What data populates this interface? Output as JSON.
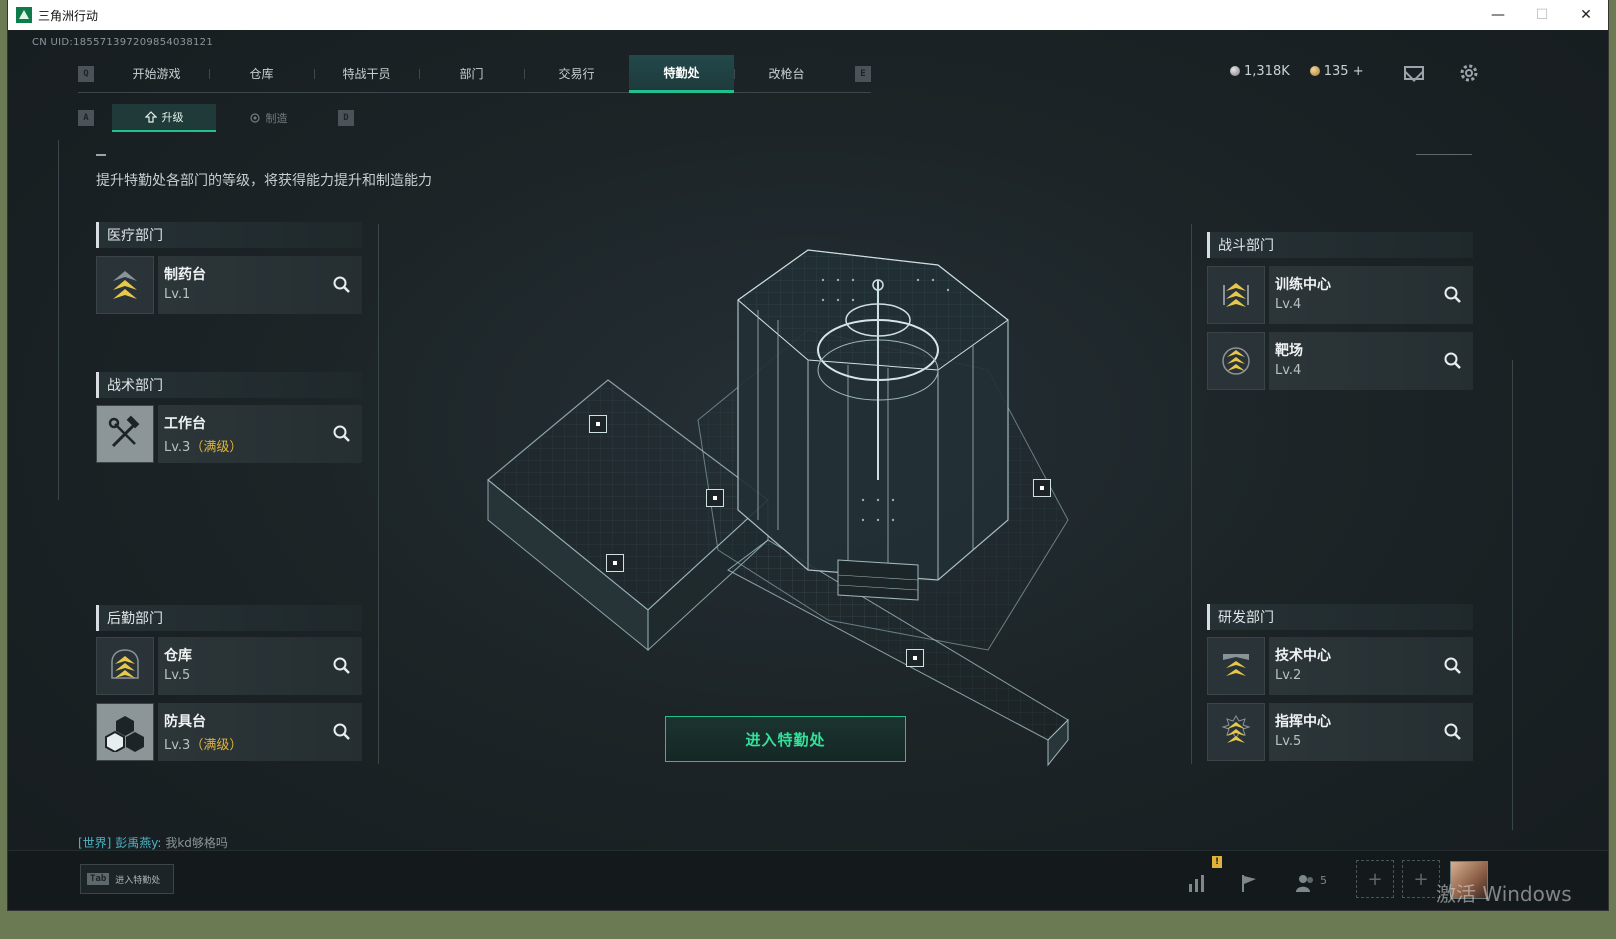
{
  "window": {
    "title": "三角洲行动",
    "minimize_glyph": "—",
    "maximize_glyph": "☐",
    "close_glyph": "✕"
  },
  "uid_text": "CN UID:1855713972098540381​21",
  "nav": {
    "left_key": "Q",
    "right_key": "E",
    "tabs": [
      {
        "label": "开始游戏",
        "active": false
      },
      {
        "label": "仓库",
        "active": false
      },
      {
        "label": "特战干员",
        "active": false
      },
      {
        "label": "部门",
        "active": false
      },
      {
        "label": "交易行",
        "active": false
      },
      {
        "label": "特勤处",
        "active": true
      },
      {
        "label": "改枪台",
        "active": false
      }
    ]
  },
  "currency": {
    "silver": "1,318K",
    "gold": "135 +"
  },
  "subnav": {
    "left_key": "A",
    "right_key": "D",
    "tabs": [
      {
        "label": "升级",
        "icon": "upgrade-icon",
        "active": true
      },
      {
        "label": "制造",
        "icon": "craft-icon",
        "active": false
      }
    ]
  },
  "description": "提升特勤处各部门的等级，将获得能力提升和制造能力",
  "departments": {
    "medical": {
      "title": "医疗部门",
      "facilities": [
        {
          "name": "制药台",
          "level": "Lv.1",
          "max": ""
        }
      ]
    },
    "tactical": {
      "title": "战术部门",
      "facilities": [
        {
          "name": "工作台",
          "level": "Lv.3",
          "max": "（满级）"
        }
      ]
    },
    "logistics": {
      "title": "后勤部门",
      "facilities": [
        {
          "name": "仓库",
          "level": "Lv.5",
          "max": ""
        },
        {
          "name": "防具台",
          "level": "Lv.3",
          "max": "（满级）"
        }
      ]
    },
    "combat": {
      "title": "战斗部门",
      "facilities": [
        {
          "name": "训练中心",
          "level": "Lv.4",
          "max": ""
        },
        {
          "name": "靶场",
          "level": "Lv.4",
          "max": ""
        }
      ]
    },
    "research": {
      "title": "研发部门",
      "facilities": [
        {
          "name": "技术中心",
          "level": "Lv.2",
          "max": ""
        },
        {
          "name": "指挥中心",
          "level": "Lv.5",
          "max": ""
        }
      ]
    }
  },
  "enter_button": "进入特勤处",
  "chat": {
    "channel": "[世界]",
    "user": "彭禹燕y:",
    "message": "我kd够格吗"
  },
  "tab_hint": {
    "key": "Tab",
    "label": "进入特勤处"
  },
  "party_count": "5",
  "watermark": "激活 Windows",
  "colors": {
    "accent": "#22c08a",
    "max_level": "#e0b23a",
    "chevron": "#e8c84a"
  }
}
